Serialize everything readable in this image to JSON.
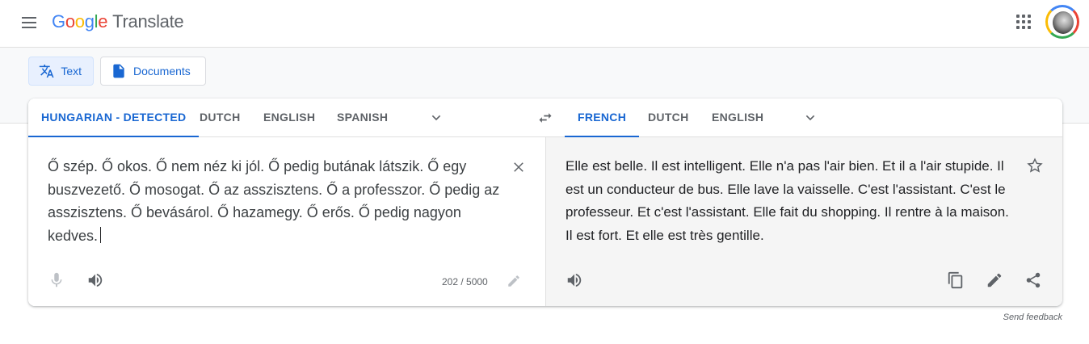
{
  "app": {
    "logo_letters": [
      "G",
      "o",
      "o",
      "g",
      "l",
      "e"
    ],
    "product": "Translate"
  },
  "modes": {
    "text_label": "Text",
    "documents_label": "Documents"
  },
  "source_langs": [
    {
      "label": "HUNGARIAN - DETECTED",
      "active": true
    },
    {
      "label": "DUTCH",
      "active": false
    },
    {
      "label": "ENGLISH",
      "active": false
    },
    {
      "label": "SPANISH",
      "active": false
    }
  ],
  "target_langs": [
    {
      "label": "FRENCH",
      "active": true
    },
    {
      "label": "DUTCH",
      "active": false
    },
    {
      "label": "ENGLISH",
      "active": false
    }
  ],
  "source": {
    "text": "Ő szép. Ő okos. Ő nem néz ki jól. Ő pedig butának látszik. Ő egy buszvezető. Ő mosogat. Ő az asszisztens. Ő a professzor. Ő pedig az asszisztens. Ő bevásárol. Ő hazamegy. Ő erős. Ő pedig nagyon kedves.",
    "char_count": "202 / 5000"
  },
  "target": {
    "text": "Elle est belle. Il est intelligent. Elle n'a pas l'air bien. Et il a l'air stupide. Il est un conducteur de bus. Elle lave la vaisselle. C'est l'assistant. C'est le professeur. Et c'est l'assistant. Elle fait du shopping. Il rentre à la maison. Il est fort. Et elle est très gentille."
  },
  "footer": {
    "feedback": "Send feedback"
  },
  "colors": {
    "accent": "#1967d2",
    "icon": "#5f6368",
    "target_bg": "#f5f5f5"
  },
  "icons": [
    "menu-icon",
    "apps-icon",
    "avatar",
    "translate-text-icon",
    "document-icon",
    "chevron-down-icon",
    "swap-icon",
    "clear-icon",
    "star-icon",
    "microphone-icon",
    "speaker-icon",
    "edit-icon",
    "copy-icon",
    "share-icon"
  ]
}
